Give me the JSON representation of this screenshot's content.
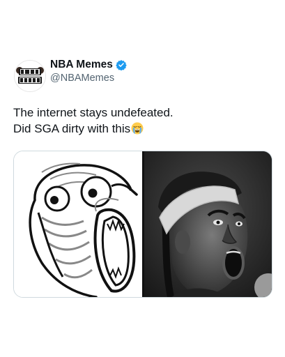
{
  "author": {
    "display_name": "NBA Memes",
    "handle": "@NBAMemes",
    "avatar_text": [
      "NBA",
      "MEMES"
    ],
    "verified": true
  },
  "tweet": {
    "line1": "The internet stays undefeated.",
    "line2": "Did SGA dirty with this",
    "emoji": "loudly-crying-face-icon"
  },
  "media": {
    "left_image": "rage-comic-lol-face",
    "right_image": "player-with-headband-shocked"
  },
  "colors": {
    "verified": "#1d9bf0",
    "text": "#0f1419",
    "secondary": "#536471"
  }
}
